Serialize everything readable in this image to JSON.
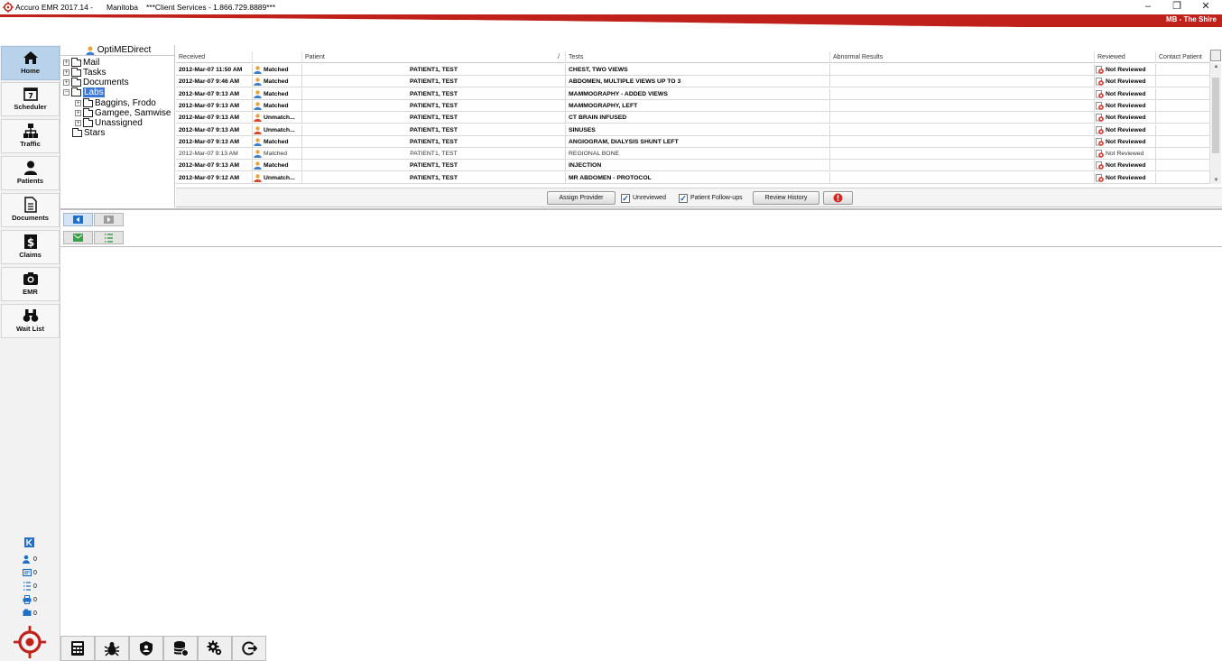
{
  "titlebar": {
    "app": "Accuro EMR 2017.14 -",
    "province": "Manitoba",
    "support": "***Client Services - 1.866.729.8889***",
    "min": "–",
    "restore": "❐",
    "close": "✕",
    "location": "MB - The Shire"
  },
  "nav": {
    "items": [
      {
        "label": "Home"
      },
      {
        "label": "Scheduler"
      },
      {
        "label": "Traffic"
      },
      {
        "label": "Patients"
      },
      {
        "label": "Documents"
      },
      {
        "label": "Claims"
      },
      {
        "label": "EMR"
      },
      {
        "label": "Wait List"
      }
    ]
  },
  "status": {
    "counts": [
      "0",
      "0",
      "0",
      "0",
      "0"
    ]
  },
  "tree": {
    "root": "OptiMEDirect",
    "mail": "Mail",
    "tasks": "Tasks",
    "documents": "Documents",
    "labs": "Labs",
    "baggins": "Baggins, Frodo",
    "gamgee": "Gamgee, Samwise",
    "unassigned": "Unassigned",
    "stars": "Stars"
  },
  "grid": {
    "headers": [
      "Received",
      "Patient",
      "Tests",
      "Abnormal Results",
      "Reviewed",
      "Contact Patient"
    ],
    "sort_marker": "/",
    "rows": [
      {
        "received": "2012-Mar-07 11:50 AM",
        "match": "Matched",
        "patient": "PATIENT1, TEST",
        "test": "CHEST, TWO VIEWS",
        "abnormal": "",
        "reviewed": "Not Reviewed",
        "contact": ""
      },
      {
        "received": "2012-Mar-07 9:46 AM",
        "match": "Matched",
        "patient": "PATIENT1, TEST",
        "test": "ABDOMEN, MULTIPLE VIEWS UP TO 3",
        "abnormal": "",
        "reviewed": "Not Reviewed",
        "contact": ""
      },
      {
        "received": "2012-Mar-07 9:13 AM",
        "match": "Matched",
        "patient": "PATIENT1, TEST",
        "test": "MAMMOGRAPHY - ADDED VIEWS",
        "abnormal": "",
        "reviewed": "Not Reviewed",
        "contact": ""
      },
      {
        "received": "2012-Mar-07 9:13 AM",
        "match": "Matched",
        "patient": "PATIENT1, TEST",
        "test": "MAMMOGRAPHY, LEFT",
        "abnormal": "",
        "reviewed": "Not Reviewed",
        "contact": ""
      },
      {
        "received": "2012-Mar-07 9:13 AM",
        "match": "Unmatch...",
        "patient": "PATIENT1, TEST",
        "test": "CT BRAIN INFUSED",
        "abnormal": "",
        "reviewed": "Not Reviewed",
        "contact": ""
      },
      {
        "received": "2012-Mar-07 9:13 AM",
        "match": "Unmatch...",
        "patient": "PATIENT1, TEST",
        "test": "SINUSES",
        "abnormal": "",
        "reviewed": "Not Reviewed",
        "contact": ""
      },
      {
        "received": "2012-Mar-07 9:13 AM",
        "match": "Matched",
        "patient": "PATIENT1, TEST",
        "test": "ANGIOGRAM, DIALYSIS SHUNT LEFT",
        "abnormal": "",
        "reviewed": "Not Reviewed",
        "contact": ""
      },
      {
        "received": "2012-Mar-07 9:13 AM",
        "match": "Matched",
        "patient": "PATIENT1, TEST",
        "test": "REGIONAL BONE",
        "abnormal": "",
        "reviewed": "Not Reviewed",
        "contact": ""
      },
      {
        "received": "2012-Mar-07 9:13 AM",
        "match": "Matched",
        "patient": "PATIENT1, TEST",
        "test": "INJECTION",
        "abnormal": "",
        "reviewed": "Not Reviewed",
        "contact": ""
      },
      {
        "received": "2012-Mar-07 9:12 AM",
        "match": "Unmatch...",
        "patient": "PATIENT1, TEST",
        "test": "MR ABDOMEN - PROTOCOL",
        "abnormal": "",
        "reviewed": "Not Reviewed",
        "contact": ""
      }
    ]
  },
  "actions": {
    "assign_provider": "Assign Provider",
    "unreviewed": "Unreviewed",
    "follow_ups": "Patient Follow-ups",
    "review_history": "Review History"
  },
  "colors": {
    "accent_red": "#c0221b",
    "nav_active": "#b9d2ec",
    "selection_blue": "#3c79d6"
  }
}
